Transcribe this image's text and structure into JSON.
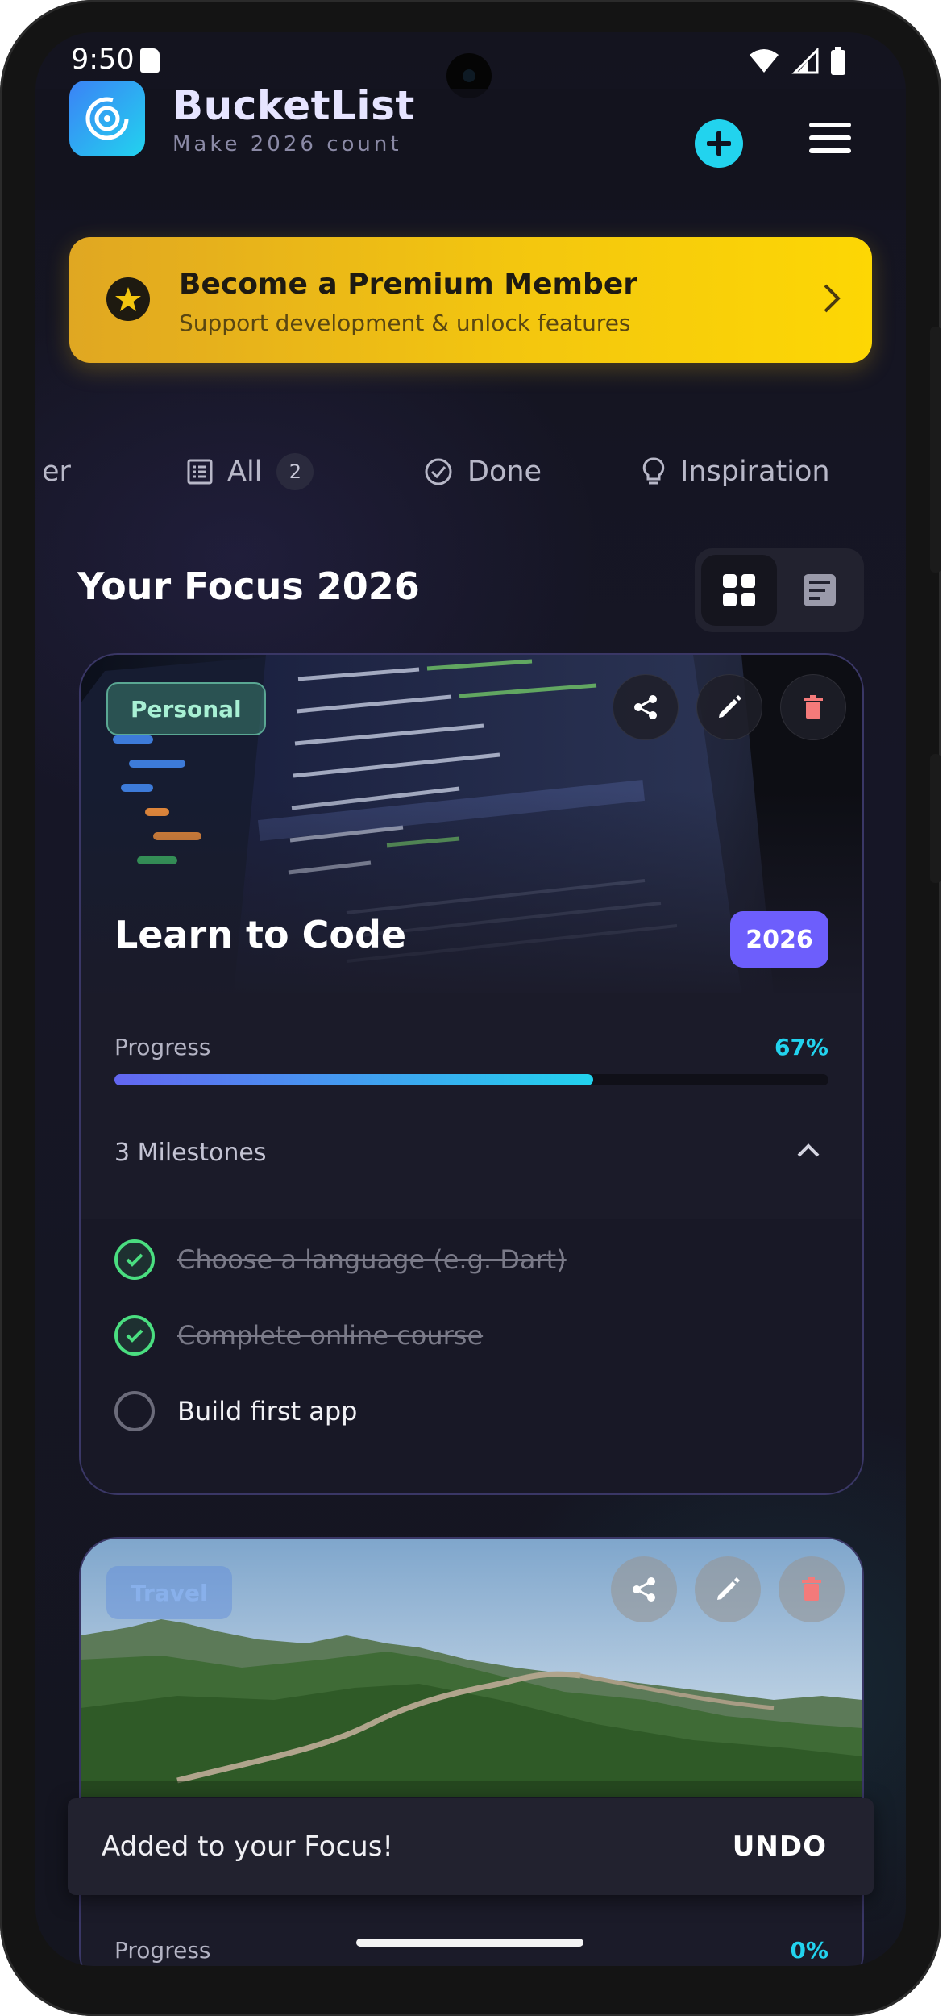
{
  "status_bar": {
    "time": "9:50"
  },
  "header": {
    "title": "BucketList",
    "subtitle": "Make 2026 count"
  },
  "premium": {
    "title": "Become a Premium Member",
    "subtitle": "Support development & unlock features"
  },
  "tabs": [
    {
      "label": "er",
      "icon": "partial-tab"
    },
    {
      "label": "All",
      "icon": "list-icon",
      "count": "2"
    },
    {
      "label": "Done",
      "icon": "check-circle-icon"
    },
    {
      "label": "Inspiration",
      "icon": "lightbulb-icon"
    }
  ],
  "section": {
    "title": "Your Focus 2026"
  },
  "cards": [
    {
      "category": "Personal",
      "title": "Learn to Code",
      "year": "2026",
      "progress_label": "Progress",
      "progress_pct": "67%",
      "progress_value": 0.67,
      "milestones_header": "3 Milestones",
      "milestones": [
        {
          "label": "Choose a language (e.g. Dart)",
          "done": true
        },
        {
          "label": "Complete online course",
          "done": true
        },
        {
          "label": "Build first app",
          "done": false
        }
      ]
    },
    {
      "category": "Travel",
      "progress_label": "Progress",
      "progress_pct": "0%",
      "progress_value": 0
    }
  ],
  "snackbar": {
    "message": "Added to your Focus!",
    "action": "UNDO"
  },
  "colors": {
    "accent": "#22d3ee",
    "premium_gradient_start": "#e0a722",
    "premium_gradient_end": "#fdd704",
    "year_chip": "#6d5efc",
    "milestone_done": "#4ade80",
    "background": "#14141f"
  }
}
